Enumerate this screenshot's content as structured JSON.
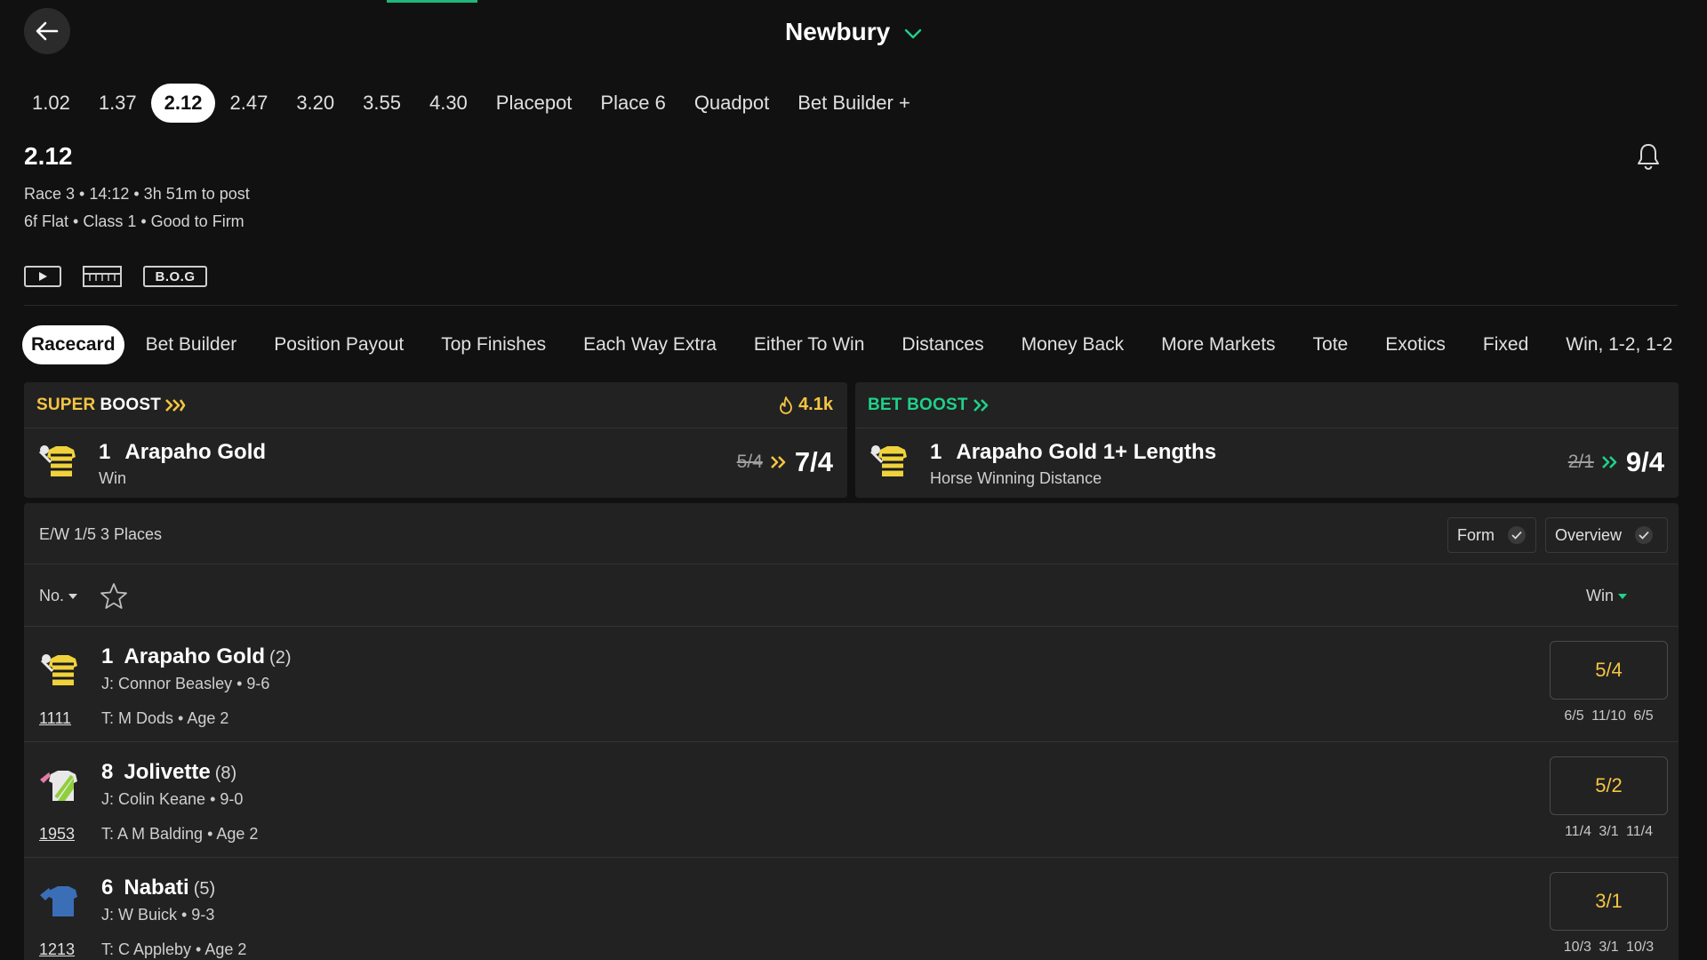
{
  "header": {
    "venue": "Newbury"
  },
  "time_tabs": [
    "1.02",
    "1.37",
    "2.12",
    "2.47",
    "3.20",
    "3.55",
    "4.30",
    "Placepot",
    "Place 6",
    "Quadpot",
    "Bet Builder +"
  ],
  "active_time_tab": "2.12",
  "race": {
    "title": "2.12",
    "meta": "Race 3 • 14:12 • 3h 51m to post",
    "meta2": "6f Flat  • Class 1  • Good to Firm",
    "bog_label": "B.O.G"
  },
  "market_tabs": [
    "Racecard",
    "Bet Builder",
    "Position Payout",
    "Top Finishes",
    "Each Way Extra",
    "Either To Win",
    "Distances",
    "Money Back",
    "More Markets",
    "Tote",
    "Exotics",
    "Fixed",
    "Win, 1-2, 1-2"
  ],
  "boosts": [
    {
      "label_a": "SUPER",
      "label_b": "BOOST",
      "hot_count": "4.1k",
      "number": "1",
      "name": "Arapaho Gold",
      "sub": "Win",
      "old_odds": "5/4",
      "new_odds": "7/4"
    },
    {
      "label_a": "BET BOOST",
      "number": "1",
      "name": "Arapaho Gold 1+ Lengths",
      "sub": "Horse Winning Distance",
      "old_odds": "2/1",
      "new_odds": "9/4"
    }
  ],
  "racecard": {
    "ew_terms": "E/W 1/5 3 Places",
    "form_toggle": "Form",
    "overview_toggle": "Overview",
    "sort_label": "No.",
    "price_label": "Win"
  },
  "runners": [
    {
      "number": "1",
      "name": "Arapaho Gold",
      "draw": "(2)",
      "jockey": "J: Connor Beasley • 9-6",
      "form": "1111",
      "trainer": "T: M Dods • Age 2",
      "odds": "5/4",
      "history": "6/5 11/10 6/5"
    },
    {
      "number": "8",
      "name": "Jolivette",
      "draw": "(8)",
      "jockey": "J: Colin Keane • 9-0",
      "form": "1953",
      "trainer": "T: A M Balding • Age 2",
      "odds": "5/2",
      "history": "11/4 3/1 11/4"
    },
    {
      "number": "6",
      "name": "Nabati",
      "draw": "(5)",
      "jockey": "J: W Buick • 9-3",
      "form": "1213",
      "trainer": "T: C Appleby • Age 2",
      "odds": "3/1",
      "history": "10/3 3/1 10/3"
    }
  ],
  "colors": {
    "background": "#111111",
    "card": "#222222",
    "accent_yellow": "#f5c542",
    "accent_green": "#1fd18a"
  },
  "icons": [
    "back-arrow-icon",
    "chevron-down-icon",
    "bell-icon",
    "play-icon",
    "grid-icon",
    "flame-icon",
    "double-chevron-icon",
    "star-icon",
    "check-icon",
    "silk-icon"
  ]
}
